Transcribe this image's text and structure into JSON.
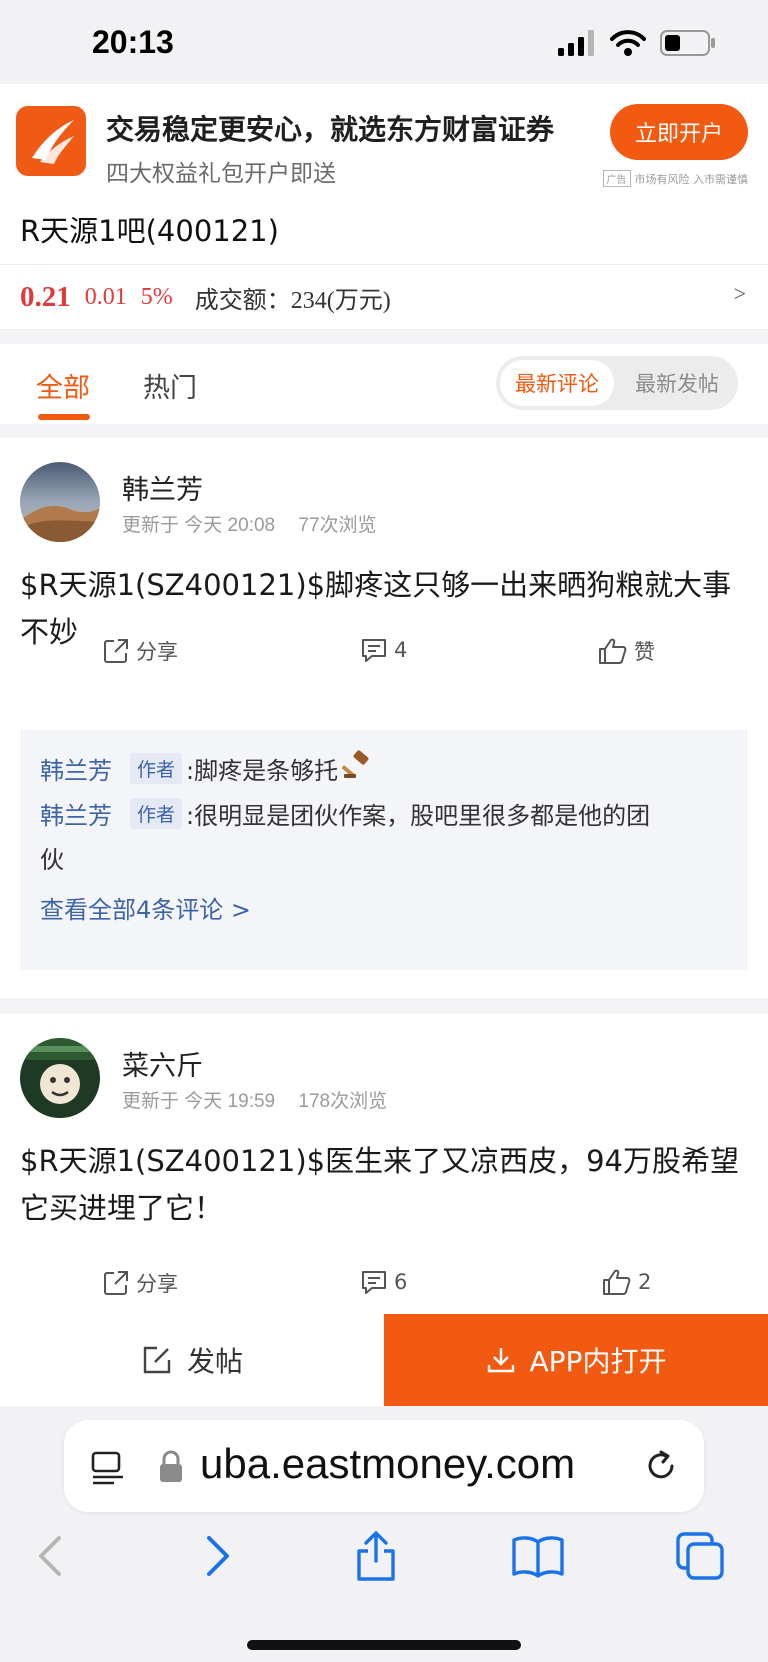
{
  "status_bar": {
    "time": "20:13"
  },
  "ad": {
    "title": "交易稳定更安心，就选东方财富证券",
    "subtitle": "四大权益礼包开户即送",
    "button": "立即开户",
    "tag": "广告",
    "disclaimer": "市场有风险 入市需谨慎",
    "brand_color": "#f25a11"
  },
  "forum": {
    "title": "R天源1吧(400121)"
  },
  "quote": {
    "price": "0.21",
    "change": "0.01",
    "change_pct": "5%",
    "turnover": "成交额：234(万元)",
    "arrow": ">"
  },
  "tabs": {
    "all": "全部",
    "hot": "热门",
    "sort_latest_comment": "最新评论",
    "sort_latest_post": "最新发帖"
  },
  "posts": [
    {
      "author": "韩兰芳",
      "updated": "更新于 今天 20:08",
      "views": "77次浏览",
      "text": "$R天源1(SZ400121)$脚疼这只够一出来晒狗粮就大事不妙",
      "share": "分享",
      "comment_count": "4",
      "like": "赞",
      "comments": [
        {
          "name": "韩兰芳",
          "badge": "作者",
          "text": ":脚疼是条够托"
        },
        {
          "name": "韩兰芳",
          "badge": "作者",
          "text": ":很明显是团伙作案，股吧里很多都是他的团",
          "text_wrap": "伙"
        }
      ],
      "view_all": "查看全部4条评论 >"
    },
    {
      "author": "菜六斤",
      "updated": "更新于 今天 19:59",
      "views": "178次浏览",
      "text": "$R天源1(SZ400121)$医生来了又凉西皮，94万股希望它买进埋了它！",
      "share": "分享",
      "comment_count": "6",
      "like": "2"
    }
  ],
  "bottom_bar": {
    "post_button": "发帖",
    "open_app_button": "APP内打开"
  },
  "browser": {
    "url": "uba.eastmoney.com",
    "tint_color": "#1a73e8"
  }
}
